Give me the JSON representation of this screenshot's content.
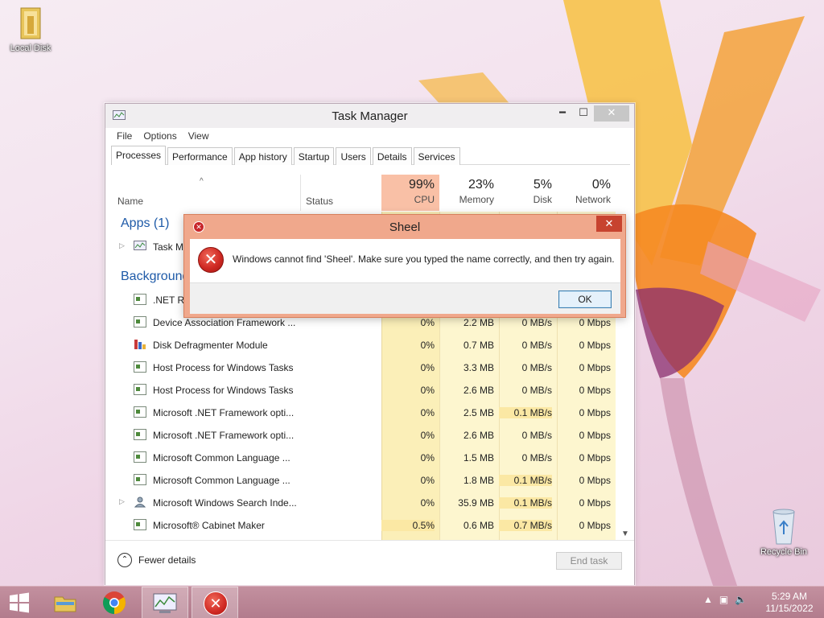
{
  "desktop": {
    "icons": [
      {
        "label": "Local Disk",
        "icon": "folder-icon"
      },
      {
        "label": "Recycle Bin",
        "icon": "recycle-bin-icon"
      }
    ]
  },
  "task_manager": {
    "title": "Task Manager",
    "menu": [
      "File",
      "Options",
      "View"
    ],
    "tabs": [
      "Processes",
      "Performance",
      "App history",
      "Startup",
      "Users",
      "Details",
      "Services"
    ],
    "active_tab": "Processes",
    "columns": {
      "name": "Name",
      "status": "Status",
      "cpu": {
        "pct": "99%",
        "label": "CPU"
      },
      "memory": {
        "pct": "23%",
        "label": "Memory"
      },
      "disk": {
        "pct": "5%",
        "label": "Disk"
      },
      "network": {
        "pct": "0%",
        "label": "Network"
      }
    },
    "groups": {
      "apps": "Apps (1)",
      "background": "Background processes (18)"
    },
    "app_rows": [
      {
        "name": "Task Manager"
      }
    ],
    "background_rows": [
      {
        "name": ".NET Runtime Optimization Service",
        "cpu": "",
        "mem": "",
        "disk": "",
        "net": ""
      },
      {
        "name": "Device Association Framework ...",
        "cpu": "0%",
        "mem": "2.2 MB",
        "disk": "0 MB/s",
        "net": "0 Mbps"
      },
      {
        "name": "Disk Defragmenter Module",
        "cpu": "0%",
        "mem": "0.7 MB",
        "disk": "0 MB/s",
        "net": "0 Mbps"
      },
      {
        "name": "Host Process for Windows Tasks",
        "cpu": "0%",
        "mem": "3.3 MB",
        "disk": "0 MB/s",
        "net": "0 Mbps"
      },
      {
        "name": "Host Process for Windows Tasks",
        "cpu": "0%",
        "mem": "2.6 MB",
        "disk": "0 MB/s",
        "net": "0 Mbps"
      },
      {
        "name": "Microsoft .NET Framework opti...",
        "cpu": "0%",
        "mem": "2.5 MB",
        "disk": "0.1 MB/s",
        "net": "0 Mbps"
      },
      {
        "name": "Microsoft .NET Framework opti...",
        "cpu": "0%",
        "mem": "2.6 MB",
        "disk": "0 MB/s",
        "net": "0 Mbps"
      },
      {
        "name": "Microsoft Common Language ...",
        "cpu": "0%",
        "mem": "1.5 MB",
        "disk": "0 MB/s",
        "net": "0 Mbps"
      },
      {
        "name": "Microsoft Common Language ...",
        "cpu": "0%",
        "mem": "1.8 MB",
        "disk": "0.1 MB/s",
        "net": "0 Mbps"
      },
      {
        "name": "Microsoft Windows Search Inde...",
        "cpu": "0%",
        "mem": "35.9 MB",
        "disk": "0.1 MB/s",
        "net": "0 Mbps"
      },
      {
        "name": "Microsoft® Cabinet Maker",
        "cpu": "0.5%",
        "mem": "0.6 MB",
        "disk": "0.7 MB/s",
        "net": "0 Mbps"
      }
    ],
    "footer": {
      "fewer_details": "Fewer details",
      "end_task": "End task"
    }
  },
  "dialog": {
    "title": "Sheel",
    "message": "Windows cannot find 'Sheel'. Make sure you typed the name correctly, and then try again.",
    "ok_label": "OK"
  },
  "taskbar": {
    "items": [
      "start-button",
      "file-explorer",
      "chrome",
      "task-manager",
      "error-dialog"
    ],
    "time": "5:29 AM",
    "date": "11/15/2022"
  },
  "colors": {
    "cpu_header": "#f9c0a6",
    "dialog_frame": "#f0a88c",
    "taskbar": "#b27c8d",
    "link_blue": "#1e5aa8"
  }
}
